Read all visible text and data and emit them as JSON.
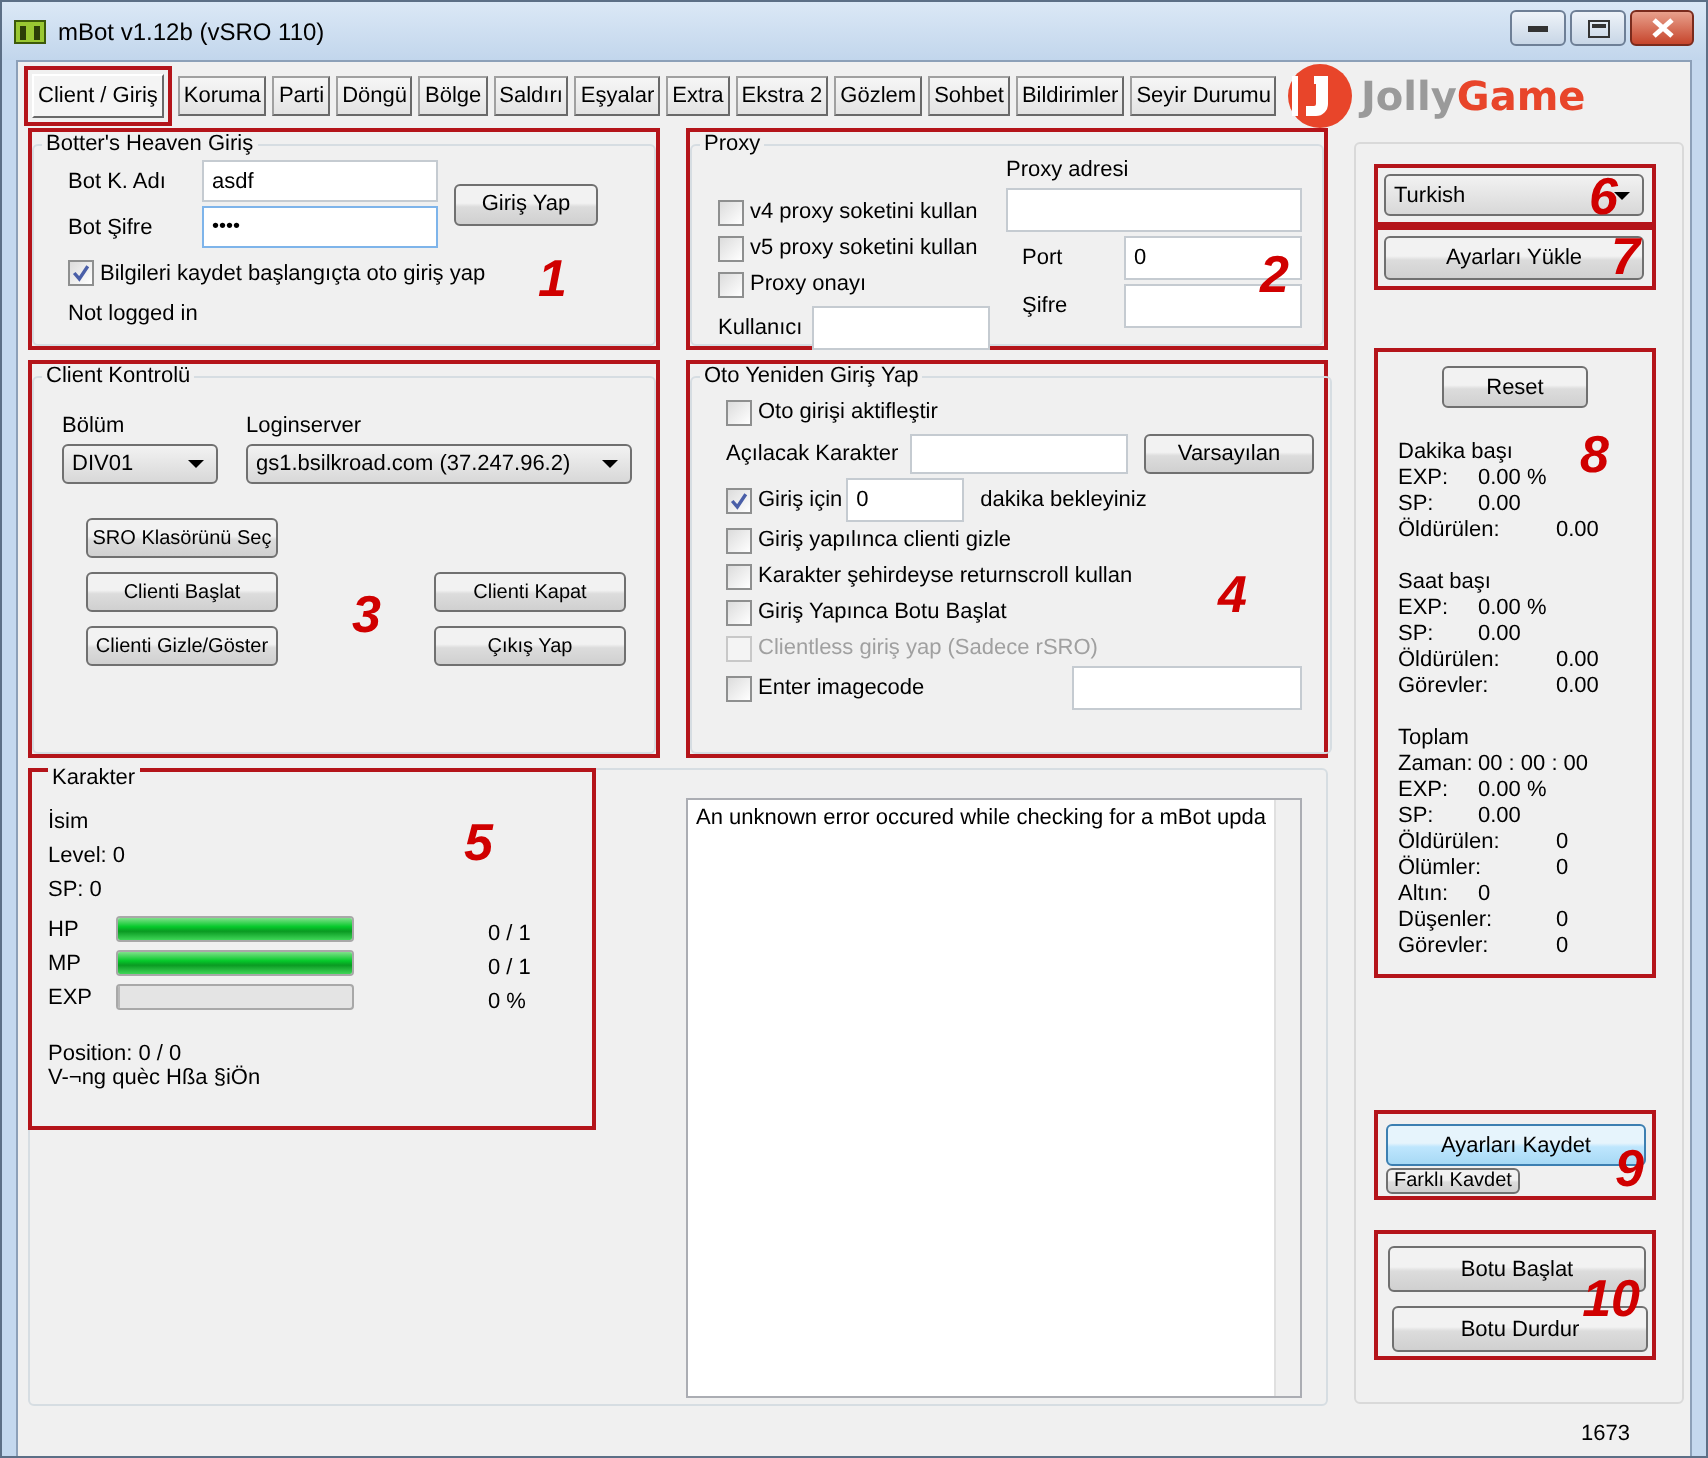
{
  "window": {
    "title": "mBot v1.12b (vSRO 110)"
  },
  "tabs": [
    {
      "label": "Client / Giriş",
      "selected": true,
      "outlined": true
    },
    {
      "label": "Koruma",
      "selected": false,
      "outlined": false
    },
    {
      "label": "Parti",
      "selected": false,
      "outlined": false
    },
    {
      "label": "Döngü",
      "selected": false,
      "outlined": false
    },
    {
      "label": "Bölge",
      "selected": false,
      "outlined": false
    },
    {
      "label": "Saldırı",
      "selected": false,
      "outlined": false
    },
    {
      "label": "Eşyalar",
      "selected": false,
      "outlined": false
    },
    {
      "label": "Extra",
      "selected": false,
      "outlined": false
    },
    {
      "label": "Ekstra 2",
      "selected": false,
      "outlined": false
    },
    {
      "label": "Gözlem",
      "selected": false,
      "outlined": false
    },
    {
      "label": "Sohbet",
      "selected": false,
      "outlined": false
    },
    {
      "label": "Bildirimler",
      "selected": false,
      "outlined": false
    },
    {
      "label": "Seyir Durumu",
      "selected": false,
      "outlined": false
    }
  ],
  "logo": {
    "parts": [
      "Jolly",
      "Game"
    ]
  },
  "login": {
    "title": "Botter's Heaven Giriş",
    "annotation": "1",
    "user_label": "Bot K. Adı",
    "user_value": "asdf",
    "password_label": "Bot Şifre",
    "password_value": "••••",
    "button": "Giriş Yap",
    "remember": {
      "label": "Bilgileri kaydet başlangıçta oto giriş yap",
      "checked": true
    },
    "status": "Not logged in"
  },
  "proxy": {
    "title": "Proxy",
    "annotation": "2",
    "checkboxes": [
      {
        "label": "v4 proxy soketini kullan",
        "checked": false
      },
      {
        "label": "v5 proxy soketini kullan",
        "checked": false
      },
      {
        "label": "Proxy onayı",
        "checked": false
      }
    ],
    "user_label": "Kullanıcı",
    "address_label": "Proxy adresi",
    "port_label": "Port",
    "port_value": "0",
    "password_label": "Şifre"
  },
  "client_control": {
    "title": "Client Kontrolü",
    "annotation": "3",
    "division_label": "Bölüm",
    "division_value": "DIV01",
    "server_label": "Loginserver",
    "server_value": "gs1.bsilkroad.com (37.247.96.2)",
    "buttons_left": [
      "SRO Klasörünü Seç",
      "Clienti Başlat",
      "Clienti Gizle/Göster"
    ],
    "buttons_right": [
      "Clienti Kapat",
      "Çıkış Yap"
    ]
  },
  "auto_login": {
    "title": "Oto Yeniden Giriş Yap",
    "annotation": "4",
    "enable": {
      "label": "Oto girişi aktifleştir",
      "checked": false,
      "disabled": false
    },
    "character_label": "Açılacak Karakter",
    "default_button": "Varsayılan",
    "wait": {
      "label": "Giriş için",
      "checked": true,
      "disabled": false,
      "value": "0",
      "suffix": "dakika bekleyiniz"
    },
    "options": [
      {
        "label": "Giriş yapılınca clienti gizle",
        "checked": false,
        "disabled": false
      },
      {
        "label": "Karakter şehirdeyse returnscroll kullan",
        "checked": false,
        "disabled": false
      },
      {
        "label": "Giriş Yapınca Botu Başlat",
        "checked": false,
        "disabled": false
      },
      {
        "label": "Clientless giriş yap (Sadece rSRO)",
        "checked": false,
        "disabled": true
      }
    ],
    "imagecode": {
      "label": "Enter imagecode",
      "checked": false,
      "disabled": false
    }
  },
  "character": {
    "title": "Karakter",
    "annotation": "5",
    "name": "İsim",
    "level": "Level: 0",
    "sp": "SP: 0",
    "bars": [
      {
        "label": "HP",
        "level": 1,
        "reading": "0 / 1"
      },
      {
        "label": "MP",
        "level": 1,
        "reading": "0 / 1"
      },
      {
        "label": "EXP",
        "level": 0,
        "reading": "0 %"
      }
    ],
    "position": "Position: 0 / 0",
    "region": "V-¬ng quèc Hßa §iÖn"
  },
  "log": {
    "lines": [
      "An unknown error occured while checking for a mBot upda"
    ]
  },
  "language": {
    "value": "Turkish",
    "annotation": "6"
  },
  "load_button": {
    "label": "Ayarları Yükle",
    "annotation": "7"
  },
  "stats": {
    "annotation": "8",
    "reset": "Reset",
    "sections": [
      {
        "title": "Dakika başı",
        "rows": [
          {
            "label": "EXP:",
            "value": "0.00 %",
            "kind": "near"
          },
          {
            "label": "SP:",
            "value": "0.00",
            "kind": "near"
          },
          {
            "label": "Öldürülen:",
            "value": "0.00",
            "kind": "far"
          }
        ]
      },
      {
        "title": "Saat başı",
        "rows": [
          {
            "label": "EXP:",
            "value": "0.00 %",
            "kind": "near"
          },
          {
            "label": "SP:",
            "value": "0.00",
            "kind": "near"
          },
          {
            "label": "Öldürülen:",
            "value": "0.00",
            "kind": "far"
          },
          {
            "label": "Görevler:",
            "value": "0.00",
            "kind": "far"
          }
        ]
      },
      {
        "title": "Toplam",
        "rows": [
          {
            "label": "Zaman:",
            "value": "00 : 00 : 00",
            "kind": "near"
          },
          {
            "label": "EXP:",
            "value": "0.00 %",
            "kind": "near"
          },
          {
            "label": "SP:",
            "value": "0.00",
            "kind": "near"
          },
          {
            "label": "Öldürülen:",
            "value": "0",
            "kind": "far"
          },
          {
            "label": "Ölümler:",
            "value": "0",
            "kind": "far"
          },
          {
            "label": "Altın:",
            "value": "0",
            "kind": "near"
          },
          {
            "label": "Düşenler:",
            "value": "0",
            "kind": "far"
          },
          {
            "label": "Görevler:",
            "value": "0",
            "kind": "far"
          }
        ]
      }
    ]
  },
  "save": {
    "annotation": "9",
    "save_button": "Ayarları Kaydet",
    "save_as_button": "Farklı Kavdet"
  },
  "run": {
    "annotation": "10",
    "start_button": "Botu Başlat",
    "stop_button": "Botu Durdur"
  },
  "status_bar": {
    "text": "1673"
  }
}
